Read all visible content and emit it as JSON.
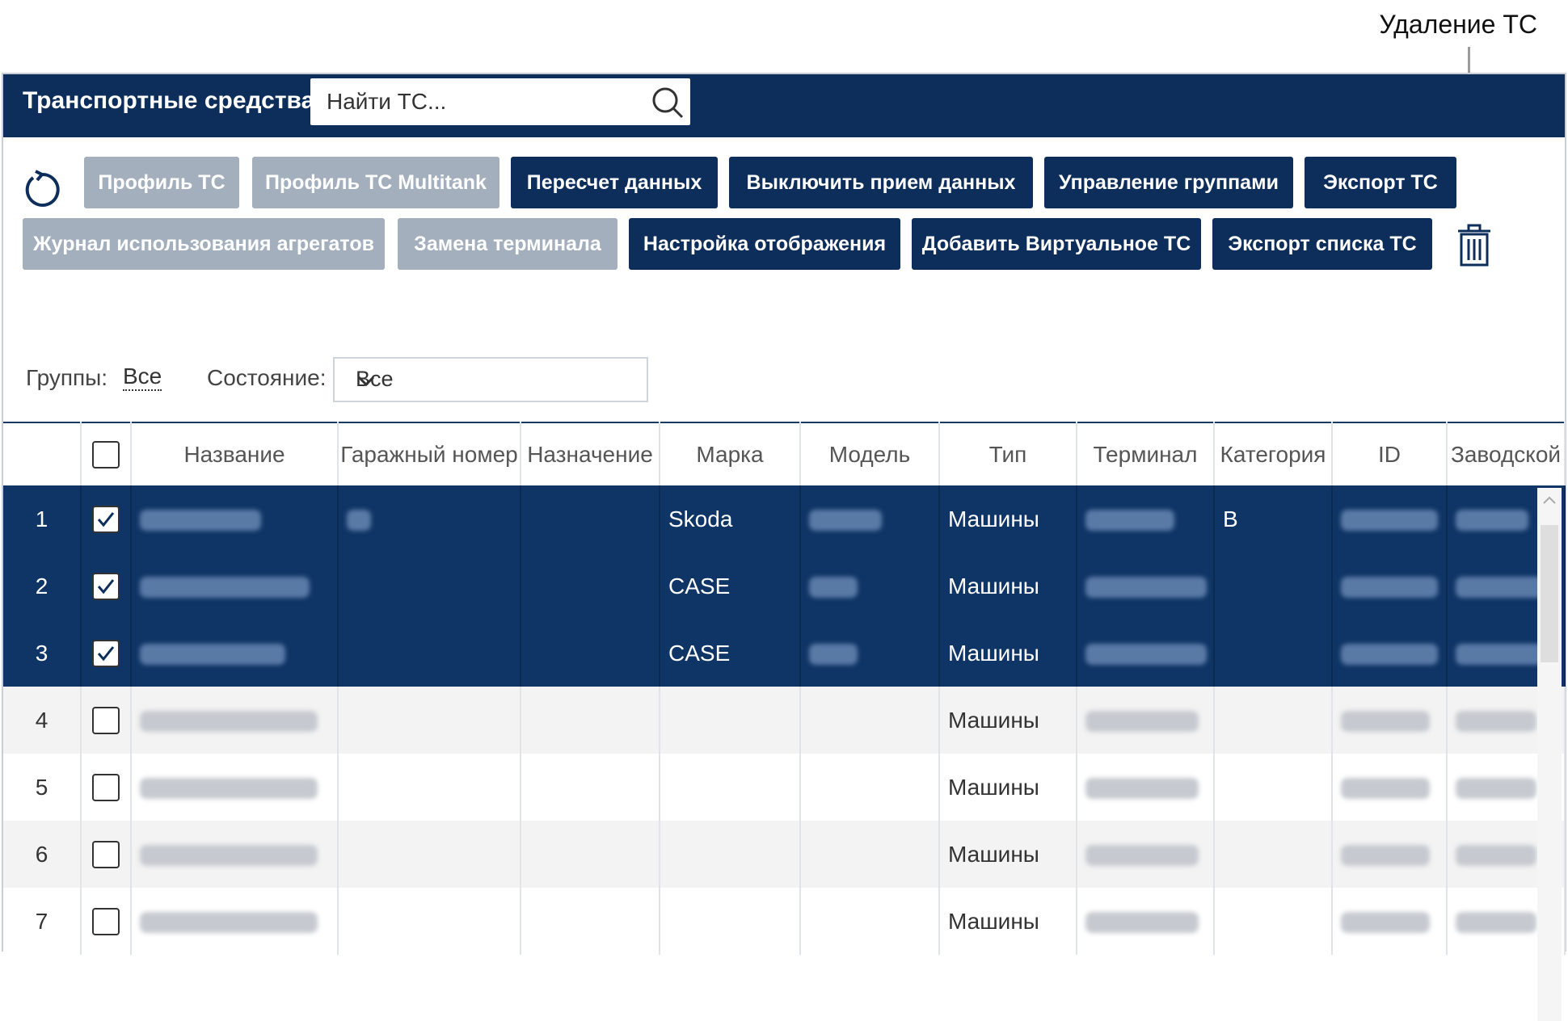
{
  "callout": {
    "label": "Удаление ТС"
  },
  "header": {
    "title": "Транспортные средства",
    "search_placeholder": "Найти ТС..."
  },
  "toolbar": {
    "row1": [
      "Профиль ТС",
      "Профиль ТС Multitank",
      "Пересчет данных",
      "Выключить прием данных",
      "Управление группами",
      "Экспорт ТС"
    ],
    "row2": [
      "Журнал использования агрегатов",
      "Замена терминала",
      "Настройка отображения",
      "Добавить Виртуальное ТС",
      "Экспорт списка ТС"
    ]
  },
  "filters": {
    "groups_label": "Группы:",
    "groups_value": "Все",
    "state_label": "Состояние:",
    "state_value": "Все"
  },
  "table": {
    "columns": [
      "Название",
      "Гаражный номер",
      "Назначение",
      "Марка",
      "Модель",
      "Тип",
      "Терминал",
      "Категория",
      "ID",
      "Заводской"
    ],
    "rows": [
      {
        "num": "1",
        "checked": true,
        "brand": "Skoda",
        "type": "Машины",
        "category": "B"
      },
      {
        "num": "2",
        "checked": true,
        "brand": "CASE",
        "type": "Машины",
        "category": ""
      },
      {
        "num": "3",
        "checked": true,
        "brand": "CASE",
        "type": "Машины",
        "category": ""
      },
      {
        "num": "4",
        "checked": false,
        "brand": "",
        "type": "Машины",
        "category": ""
      },
      {
        "num": "5",
        "checked": false,
        "brand": "",
        "type": "Машины",
        "category": ""
      },
      {
        "num": "6",
        "checked": false,
        "brand": "",
        "type": "Машины",
        "category": ""
      },
      {
        "num": "7",
        "checked": false,
        "brand": "",
        "type": "Машины",
        "category": ""
      }
    ]
  },
  "colors": {
    "navy": "#0d2d5a",
    "selected_row": "#0f3566",
    "disabled_button": "#a3afbd"
  }
}
